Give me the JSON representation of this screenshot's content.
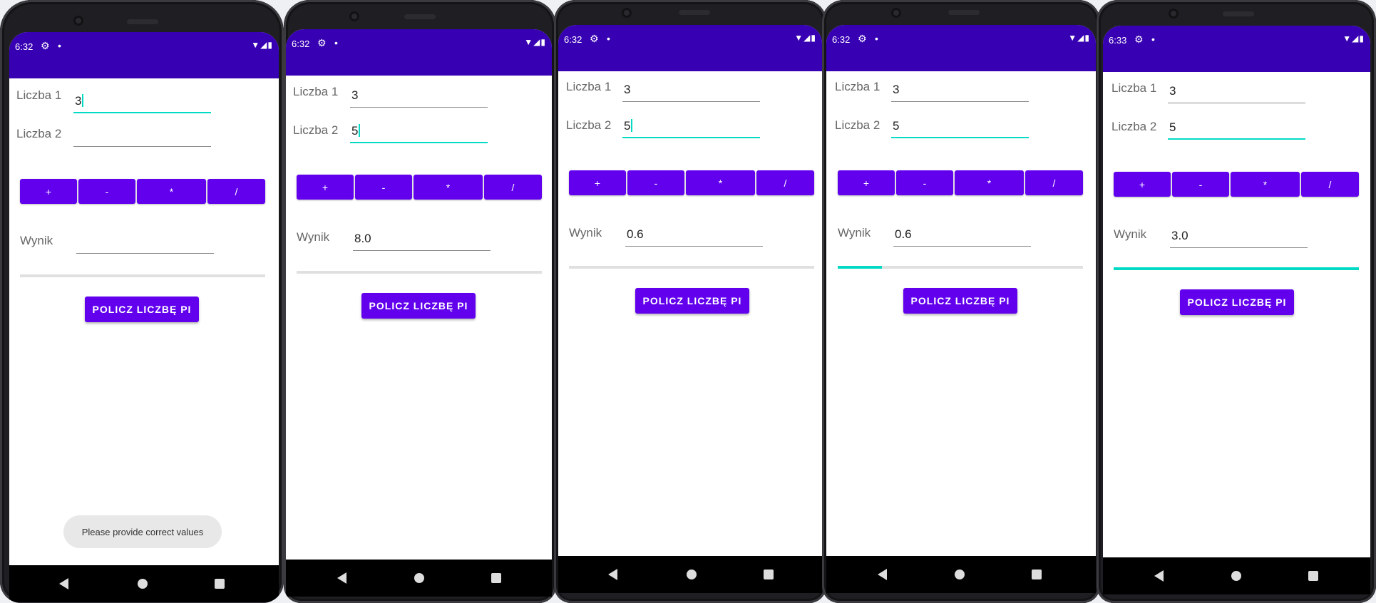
{
  "phones": [
    {
      "status_time": "6:32",
      "label1": "Liczba 1",
      "label2": "Liczba 2",
      "input1": "3",
      "input2": "",
      "ops": [
        "+",
        "-",
        "*",
        "/"
      ],
      "result_label": "Wynik",
      "result_value": "",
      "pi_button": "POLICZ LICZBĘ PI",
      "toast": "Please provide correct values",
      "progress": 0
    },
    {
      "status_time": "6:32",
      "label1": "Liczba 1",
      "label2": "Liczba 2",
      "input1": "3",
      "input2": "5",
      "ops": [
        "+",
        "-",
        "*",
        "/"
      ],
      "result_label": "Wynik",
      "result_value": "8.0",
      "pi_button": "POLICZ LICZBĘ PI",
      "progress": 0
    },
    {
      "status_time": "6:32",
      "label1": "Liczba 1",
      "label2": "Liczba 2",
      "input1": "3",
      "input2": "5",
      "ops": [
        "+",
        "-",
        "*",
        "/"
      ],
      "result_label": "Wynik",
      "result_value": "0.6",
      "pi_button": "POLICZ LICZBĘ PI",
      "progress": 0
    },
    {
      "status_time": "6:32",
      "label1": "Liczba 1",
      "label2": "Liczba 2",
      "input1": "3",
      "input2": "5",
      "ops": [
        "+",
        "-",
        "*",
        "/"
      ],
      "result_label": "Wynik",
      "result_value": "0.6",
      "pi_button": "POLICZ LICZBĘ PI",
      "progress": 0.18
    },
    {
      "status_time": "6:33",
      "label1": "Liczba 1",
      "label2": "Liczba 2",
      "input1": "3",
      "input2": "5",
      "ops": [
        "+",
        "-",
        "*",
        "/"
      ],
      "result_label": "Wynik",
      "result_value": "3.0",
      "pi_button": "POLICZ LICZBĘ PI",
      "progress": 1.0
    }
  ],
  "colors": {
    "primary_dark": "#3700b3",
    "primary": "#6200ee",
    "accent": "#03dac5"
  },
  "icons": {
    "settings": "gear-icon",
    "wifi": "wifi-icon",
    "signal": "signal-icon",
    "battery": "battery-icon",
    "back": "back-icon",
    "home": "home-icon",
    "recents": "recents-icon"
  }
}
